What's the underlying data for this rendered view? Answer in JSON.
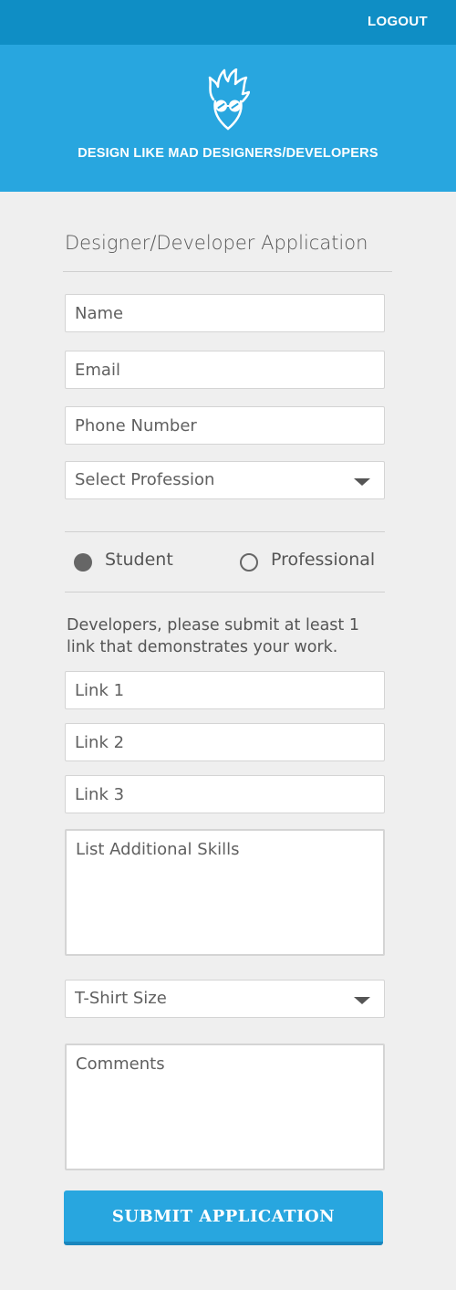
{
  "header": {
    "logout_label": "LOGOUT"
  },
  "hero": {
    "tagline": "DESIGN LIKE MAD DESIGNERS/DEVELOPERS",
    "logo_icon": "mad-designer-logo-icon"
  },
  "form": {
    "title": "Designer/Developer Application",
    "name_placeholder": "Name",
    "email_placeholder": "Email",
    "phone_placeholder": "Phone Number",
    "profession_select": "Select Profession",
    "radio": [
      {
        "label": "Student",
        "selected": true
      },
      {
        "label": "Professional",
        "selected": false
      }
    ],
    "links_note": "Developers, please submit at least 1 link that demonstrates your work.",
    "link1_placeholder": "Link 1",
    "link2_placeholder": "Link 2",
    "link3_placeholder": "Link 3",
    "skills_placeholder": "List Additional Skills",
    "tshirt_select": "T-Shirt Size",
    "comments_placeholder": "Comments",
    "submit_label": "SUBMIT APPLICATION"
  },
  "colors": {
    "topbar": "#0f8ec5",
    "hero": "#28a6df",
    "background": "#efefef",
    "button": "#28a6df"
  }
}
